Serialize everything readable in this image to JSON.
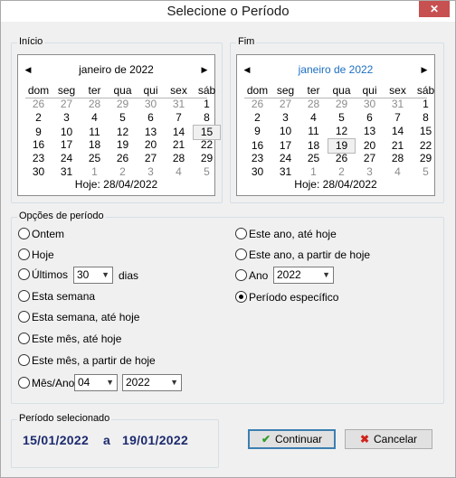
{
  "window": {
    "title": "Selecione o Período",
    "close_glyph": "✕"
  },
  "start": {
    "legend": "Início",
    "month_label": "janeiro de 2022",
    "month_color": "#000000",
    "prev_glyph": "◀",
    "next_glyph": "▶",
    "dow": [
      "dom",
      "seg",
      "ter",
      "qua",
      "qui",
      "sex",
      "sáb"
    ],
    "weeks": [
      [
        {
          "d": "26",
          "o": true
        },
        {
          "d": "27",
          "o": true
        },
        {
          "d": "28",
          "o": true
        },
        {
          "d": "29",
          "o": true
        },
        {
          "d": "30",
          "o": true
        },
        {
          "d": "31",
          "o": true
        },
        {
          "d": "1"
        }
      ],
      [
        {
          "d": "2"
        },
        {
          "d": "3"
        },
        {
          "d": "4"
        },
        {
          "d": "5"
        },
        {
          "d": "6"
        },
        {
          "d": "7"
        },
        {
          "d": "8"
        }
      ],
      [
        {
          "d": "9"
        },
        {
          "d": "10"
        },
        {
          "d": "11"
        },
        {
          "d": "12"
        },
        {
          "d": "13"
        },
        {
          "d": "14"
        },
        {
          "d": "15",
          "s": true
        }
      ],
      [
        {
          "d": "16"
        },
        {
          "d": "17"
        },
        {
          "d": "18"
        },
        {
          "d": "19"
        },
        {
          "d": "20"
        },
        {
          "d": "21"
        },
        {
          "d": "22"
        }
      ],
      [
        {
          "d": "23"
        },
        {
          "d": "24"
        },
        {
          "d": "25"
        },
        {
          "d": "26"
        },
        {
          "d": "27"
        },
        {
          "d": "28"
        },
        {
          "d": "29"
        }
      ],
      [
        {
          "d": "30"
        },
        {
          "d": "31"
        },
        {
          "d": "1",
          "o": true
        },
        {
          "d": "2",
          "o": true
        },
        {
          "d": "3",
          "o": true
        },
        {
          "d": "4",
          "o": true
        },
        {
          "d": "5",
          "o": true
        }
      ]
    ],
    "today_label": "Hoje: 28/04/2022"
  },
  "end": {
    "legend": "Fim",
    "month_label": "janeiro de 2022",
    "month_color": "#1e6fc2",
    "prev_glyph": "◀",
    "next_glyph": "▶",
    "dow": [
      "dom",
      "seg",
      "ter",
      "qua",
      "qui",
      "sex",
      "sáb"
    ],
    "weeks": [
      [
        {
          "d": "26",
          "o": true
        },
        {
          "d": "27",
          "o": true
        },
        {
          "d": "28",
          "o": true
        },
        {
          "d": "29",
          "o": true
        },
        {
          "d": "30",
          "o": true
        },
        {
          "d": "31",
          "o": true
        },
        {
          "d": "1"
        }
      ],
      [
        {
          "d": "2"
        },
        {
          "d": "3"
        },
        {
          "d": "4"
        },
        {
          "d": "5"
        },
        {
          "d": "6"
        },
        {
          "d": "7"
        },
        {
          "d": "8"
        }
      ],
      [
        {
          "d": "9"
        },
        {
          "d": "10"
        },
        {
          "d": "11"
        },
        {
          "d": "12"
        },
        {
          "d": "13"
        },
        {
          "d": "14"
        },
        {
          "d": "15"
        }
      ],
      [
        {
          "d": "16"
        },
        {
          "d": "17"
        },
        {
          "d": "18"
        },
        {
          "d": "19",
          "s": true
        },
        {
          "d": "20"
        },
        {
          "d": "21"
        },
        {
          "d": "22"
        }
      ],
      [
        {
          "d": "23"
        },
        {
          "d": "24"
        },
        {
          "d": "25"
        },
        {
          "d": "26"
        },
        {
          "d": "27"
        },
        {
          "d": "28"
        },
        {
          "d": "29"
        }
      ],
      [
        {
          "d": "30"
        },
        {
          "d": "31"
        },
        {
          "d": "1",
          "o": true
        },
        {
          "d": "2",
          "o": true
        },
        {
          "d": "3",
          "o": true
        },
        {
          "d": "4",
          "o": true
        },
        {
          "d": "5",
          "o": true
        }
      ]
    ],
    "today_label": "Hoje: 28/04/2022"
  },
  "options": {
    "legend": "Opções de período",
    "ontem": "Ontem",
    "hoje": "Hoje",
    "ultimos": "Últimos",
    "ultimos_value": "30",
    "dias": "dias",
    "esta_semana": "Esta semana",
    "esta_semana_ate_hoje": "Esta semana, até hoje",
    "este_mes_ate_hoje": "Este mês, até hoje",
    "este_mes_a_partir": "Este mês, a partir de hoje",
    "mes_ano": "Mês/Ano",
    "mes_value": "04",
    "mes_ano_year": "2022",
    "este_ano_ate_hoje": "Este ano, até hoje",
    "este_ano_a_partir": "Este ano, a partir de hoje",
    "ano": "Ano",
    "ano_value": "2022",
    "periodo_especifico": "Período específico",
    "selected_option": "periodo_especifico",
    "combo_caret": "▼"
  },
  "selection": {
    "legend": "Período selecionado",
    "start_date": "15/01/2022",
    "separator": "a",
    "end_date": "19/01/2022"
  },
  "buttons": {
    "continuar": "Continuar",
    "continuar_icon": "✔",
    "continuar_icon_color": "#2e9e2e",
    "cancelar": "Cancelar",
    "cancelar_icon": "✖",
    "cancelar_icon_color": "#d0231c"
  }
}
